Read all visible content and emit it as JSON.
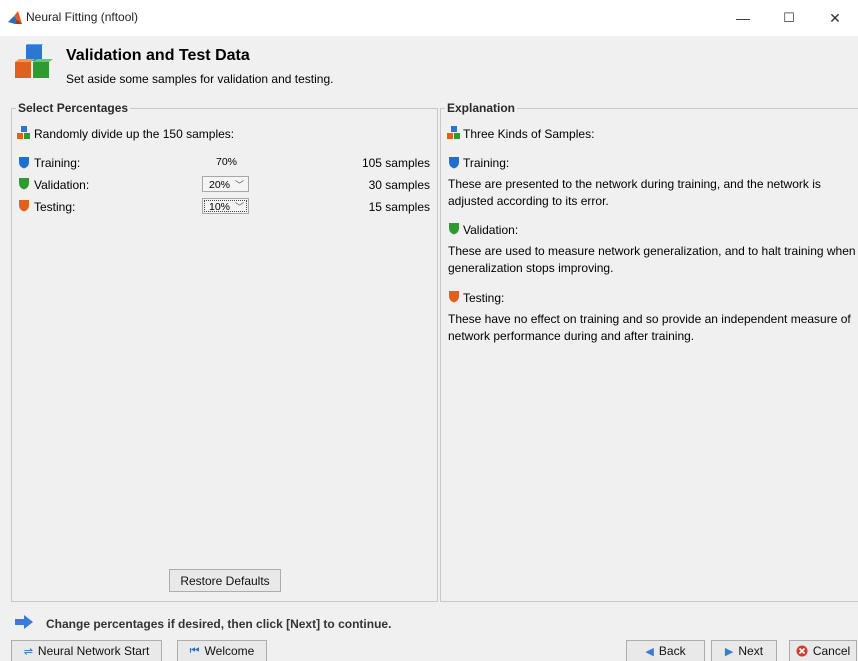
{
  "window": {
    "title": "Neural Fitting (nftool)",
    "minimize": "—",
    "maximize": "☐",
    "close": "✕"
  },
  "header": {
    "title": "Validation and Test Data",
    "subtitle": "Set aside some samples for validation and testing."
  },
  "select": {
    "group_title": "Select Percentages",
    "intro": "Randomly divide up the 150 samples:",
    "rows": [
      {
        "label": "Training:",
        "percent": "70%",
        "samples": "105 samples",
        "icon": "blue-shield-icon"
      },
      {
        "label": "Validation:",
        "percent": "20%",
        "samples": "30 samples",
        "icon": "green-shield-icon"
      },
      {
        "label": "Testing:",
        "percent": "10%",
        "samples": "15 samples",
        "icon": "orange-shield-icon"
      }
    ],
    "restore_label": "Restore Defaults"
  },
  "explanation": {
    "group_title": "Explanation",
    "intro": "Three Kinds of Samples:",
    "training_title": "Training:",
    "training_line1": "These are presented to the network during training, and the network is",
    "training_line2": "adjusted according to its error.",
    "validation_title": "Validation:",
    "validation_line1": "These are used to measure network generalization, and to halt training when",
    "validation_line2": "generalization stops improving.",
    "testing_title": "Testing:",
    "testing_line1": "These have no effect on training and so provide an independent measure of",
    "testing_line2": "network performance during and after training."
  },
  "footer": {
    "hint": "Change percentages if desired, then click [Next] to continue.",
    "nn_start": "Neural Network Start",
    "welcome": "Welcome",
    "back": "Back",
    "next": "Next",
    "cancel": "Cancel"
  },
  "colors": {
    "blue": "#1f6fd1",
    "green": "#2f9a2f",
    "orange": "#e0601c",
    "arrow": "#3a7ad8",
    "cancel_red": "#d23b2b"
  }
}
